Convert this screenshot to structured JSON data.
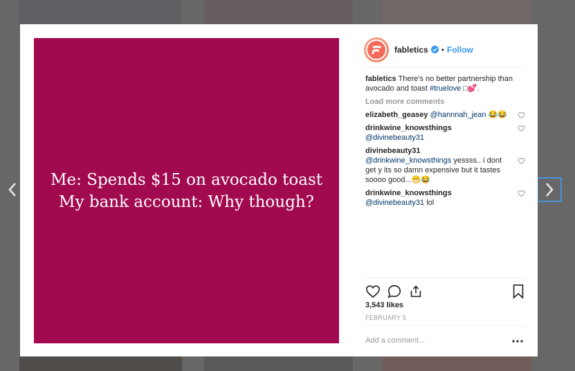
{
  "post": {
    "image_text_line1": "Me: Spends $15 on avocado toast",
    "image_text_line2": "My bank account: Why though?",
    "image_bg_color": "#a10a4f"
  },
  "header": {
    "username": "fabletics",
    "separator": "•",
    "follow_label": "Follow"
  },
  "caption": {
    "username": "fabletics",
    "text": " There’s no better partnership than avocado and toast ",
    "hashtag": "#truelove",
    "suffix": " □💕."
  },
  "load_more": "Load more comments",
  "comments": [
    {
      "username": "elizabeth_geasey",
      "mention": "@hannnah_jean",
      "text": " 😂😂"
    },
    {
      "username": "drinkwine_knowsthings",
      "mention": "@divinebeauty31",
      "text": ""
    },
    {
      "username": "divinebeauty31",
      "mention": "@drinkwine_knowsthings",
      "text": " yessss.. i dont get y its so damn expensive but it tastes soooo good...😁😂"
    },
    {
      "username": "drinkwine_knowsthings",
      "mention": "@divinebeauty31",
      "text": " lol"
    }
  ],
  "likes": "3,543 likes",
  "date": "FEBRUARY 5",
  "add_comment_placeholder": "Add a comment...",
  "icons": {
    "like": "heart-icon",
    "comment": "comment-icon",
    "share": "share-icon",
    "save": "bookmark-icon",
    "more": "more-options-icon",
    "verified": "verified-badge-icon",
    "prev": "chevron-left-icon",
    "next": "chevron-right-icon"
  },
  "colors": {
    "accent": "#3897f0",
    "link": "#003569",
    "muted": "#999999"
  }
}
